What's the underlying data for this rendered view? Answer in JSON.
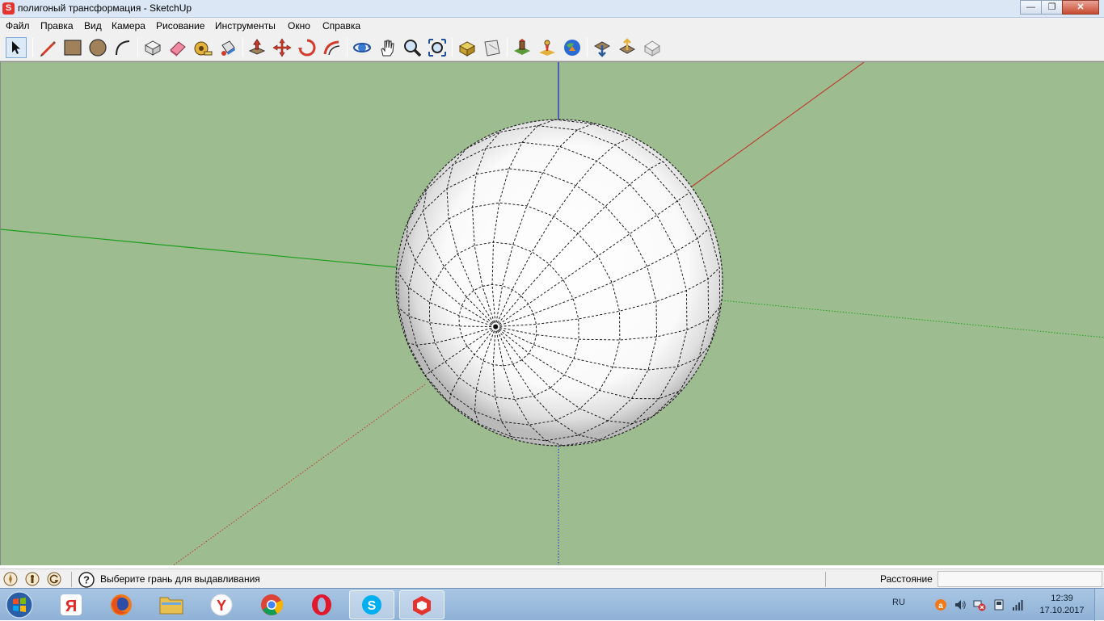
{
  "window": {
    "title": "полигоный трансформация - SketchUp",
    "app_icon": "sketchup-icon",
    "buttons": [
      "minimize",
      "maximize",
      "close"
    ]
  },
  "menu": [
    {
      "label": "Файл"
    },
    {
      "label": "Правка"
    },
    {
      "label": "Вид"
    },
    {
      "label": "Камера"
    },
    {
      "label": "Рисование"
    },
    {
      "label": "Инструменты"
    },
    {
      "label": "Окно"
    },
    {
      "label": "Справка"
    }
  ],
  "toolbar": {
    "tools": [
      "select",
      "line",
      "rectangle",
      "circle",
      "arc",
      "make-component",
      "eraser",
      "tape-measure",
      "paint-bucket",
      "push-pull",
      "move",
      "rotate",
      "follow-me",
      "orbit",
      "pan",
      "zoom",
      "zoom-extents",
      "get-models",
      "share-model",
      "add-location",
      "toggle-terrain",
      "preview-google-earth",
      "get-models-warehouse",
      "share-component",
      "extension-warehouse"
    ]
  },
  "viewport": {
    "background_color": "#9dbd90",
    "axis_colors": {
      "red": "#c0392b",
      "green": "#1e9e1e",
      "blue": "#1f2bd1"
    },
    "object": "sphere"
  },
  "status": {
    "message": "Выберите грань для выдавливания",
    "measurement_label": "Расстояние",
    "measurement_value": ""
  },
  "taskbar": {
    "apps": [
      "yandex-browser",
      "firefox",
      "file-explorer",
      "yandex",
      "chrome",
      "opera",
      "skype",
      "sketchup"
    ],
    "language": "RU",
    "time": "12:39",
    "date": "17.10.2017"
  }
}
